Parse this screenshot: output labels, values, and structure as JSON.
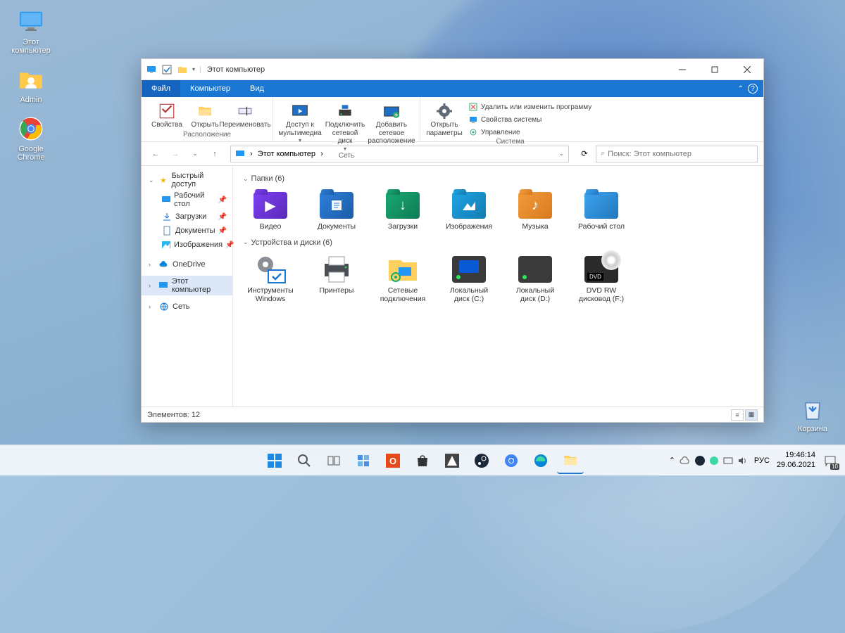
{
  "desktop": {
    "icons": [
      "Этот компьютер",
      "Admin",
      "Google Chrome"
    ],
    "recycle": "Корзина"
  },
  "window": {
    "title": "Этот компьютер",
    "tabs": [
      "Файл",
      "Компьютер",
      "Вид"
    ],
    "ribbon": {
      "group1": {
        "label": "Расположение",
        "items": [
          "Свойства",
          "Открыть",
          "Переименовать"
        ]
      },
      "group2": {
        "label": "Сеть",
        "items": [
          "Доступ к мультимедиа",
          "Подключить сетевой диск",
          "Добавить сетевое расположение"
        ]
      },
      "group3": {
        "label": "Система",
        "big": "Открыть параметры",
        "smalls": [
          "Удалить или изменить программу",
          "Свойства системы",
          "Управление"
        ]
      }
    },
    "breadcrumb": "Этот компьютер",
    "search_ph": "Поиск: Этот компьютер",
    "sidebar": {
      "quick": "Быстрый доступ",
      "items": [
        "Рабочий стол",
        "Загрузки",
        "Документы",
        "Изображения"
      ],
      "onedrive": "OneDrive",
      "thispc": "Этот компьютер",
      "network": "Сеть"
    },
    "sec1": {
      "title": "Папки (6)",
      "items": [
        "Видео",
        "Документы",
        "Загрузки",
        "Изображения",
        "Музыка",
        "Рабочий стол"
      ]
    },
    "sec2": {
      "title": "Устройства и диски (6)",
      "items": [
        "Инструменты Windows",
        "Принтеры",
        "Сетевые подключения",
        "Локальный диск (C:)",
        "Локальный диск (D:)",
        "DVD RW дисковод (F:)"
      ]
    },
    "status": "Элементов: 12"
  },
  "taskbar": {
    "lang": "РУС",
    "time": "19:46:14",
    "date": "29.06.2021",
    "noti": "10"
  }
}
